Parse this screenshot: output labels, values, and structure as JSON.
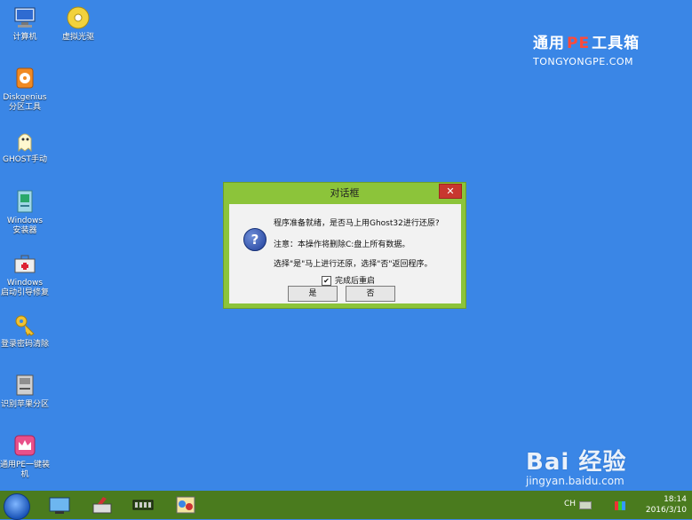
{
  "desktop": {
    "icons": [
      {
        "label": "计算机"
      },
      {
        "label": "虚拟光驱"
      },
      {
        "label": "Diskgenius\n分区工具"
      },
      {
        "label": "GHOST手动"
      },
      {
        "label": "Windows\n安装器"
      },
      {
        "label": "Windows\n启动引导修复"
      },
      {
        "label": "登录密码清除"
      },
      {
        "label": "识别苹果分区"
      },
      {
        "label": "通用PE一键装\n机"
      }
    ]
  },
  "brand": {
    "part1": "通用",
    "pe": "PE",
    "part2": "工具箱",
    "site": "TONGYONGPE.COM"
  },
  "dialog": {
    "title": "对话框",
    "close_glyph": "✕",
    "line1": "程序准备就绪，是否马上用Ghost32进行还原?",
    "line2": "注意：本操作将删除C:盘上所有数据。",
    "line3": "选择\"是\"马上进行还原，选择\"否\"返回程序。",
    "checkbox_label": "完成后重启",
    "checkbox_checked": true,
    "yes_label": "是",
    "no_label": "否"
  },
  "taskbar": {
    "lang": "CH",
    "time": "18:14",
    "date": "2016/3/10"
  },
  "watermark": {
    "brand": "Bai 经验",
    "url": "jingyan.baidu.com"
  },
  "colors": {
    "desktop": "#3a86e6",
    "dialog_frame": "#8cc43a",
    "taskbar": "#4a7b1e",
    "close": "#c8372f"
  }
}
